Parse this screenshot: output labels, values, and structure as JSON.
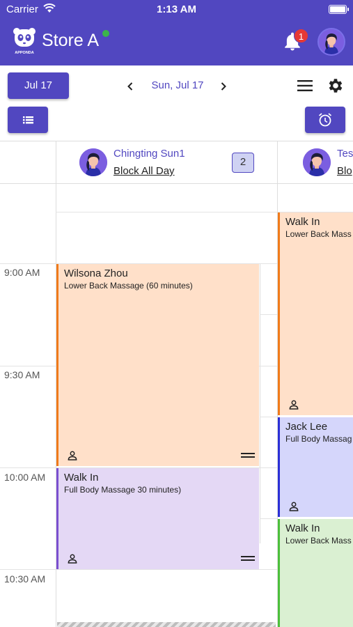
{
  "status_bar": {
    "carrier": "Carrier",
    "time": "1:13 AM",
    "icons": [
      "wifi-icon",
      "battery-icon"
    ]
  },
  "header": {
    "logo_text": "APPONDA",
    "store_name": "Store A",
    "online_status_color": "#3bb54a",
    "notification_count": "1",
    "icons": [
      "bell-icon",
      "avatar"
    ]
  },
  "toolbar": {
    "date_button": "Jul 17",
    "current_date": "Sun, Jul 17",
    "icons": [
      "chevron-left-icon",
      "chevron-right-icon",
      "menu-icon",
      "gear-icon",
      "list-icon",
      "alarm-clock-icon"
    ]
  },
  "calendar": {
    "time_slots": [
      "9:00 AM",
      "9:30 AM",
      "10:00 AM",
      "10:30 AM"
    ],
    "staff": [
      {
        "name": "Chingting Sun1",
        "block_label": "Block All Day",
        "appointment_count": "2",
        "appointments": [
          {
            "client": "Wilsona Zhou",
            "service": "Lower Back Massage (60 minutes)",
            "color": "#ffe0c9",
            "accent": "#f07a1a"
          },
          {
            "client": "Walk In",
            "service": " Full Body Massage 30 minutes)",
            "color": "#e4d8f5",
            "accent": "#7a4fd0"
          }
        ]
      },
      {
        "name": "Tes",
        "block_label": "Blo",
        "appointments": [
          {
            "client": "Walk In",
            "service": "Lower Back Mass",
            "color": "#ffe0c9",
            "accent": "#f07a1a"
          },
          {
            "client": "Jack Lee",
            "service": " Full Body Massag",
            "color": "#d5d6fb",
            "accent": "#2a2fd6"
          },
          {
            "client": "Walk In",
            "service": "Lower Back Mass",
            "color": "#daf0d2",
            "accent": "#4cbf3a"
          }
        ]
      }
    ]
  },
  "colors": {
    "brand": "#5147c0",
    "grid_line": "#dddddd"
  }
}
